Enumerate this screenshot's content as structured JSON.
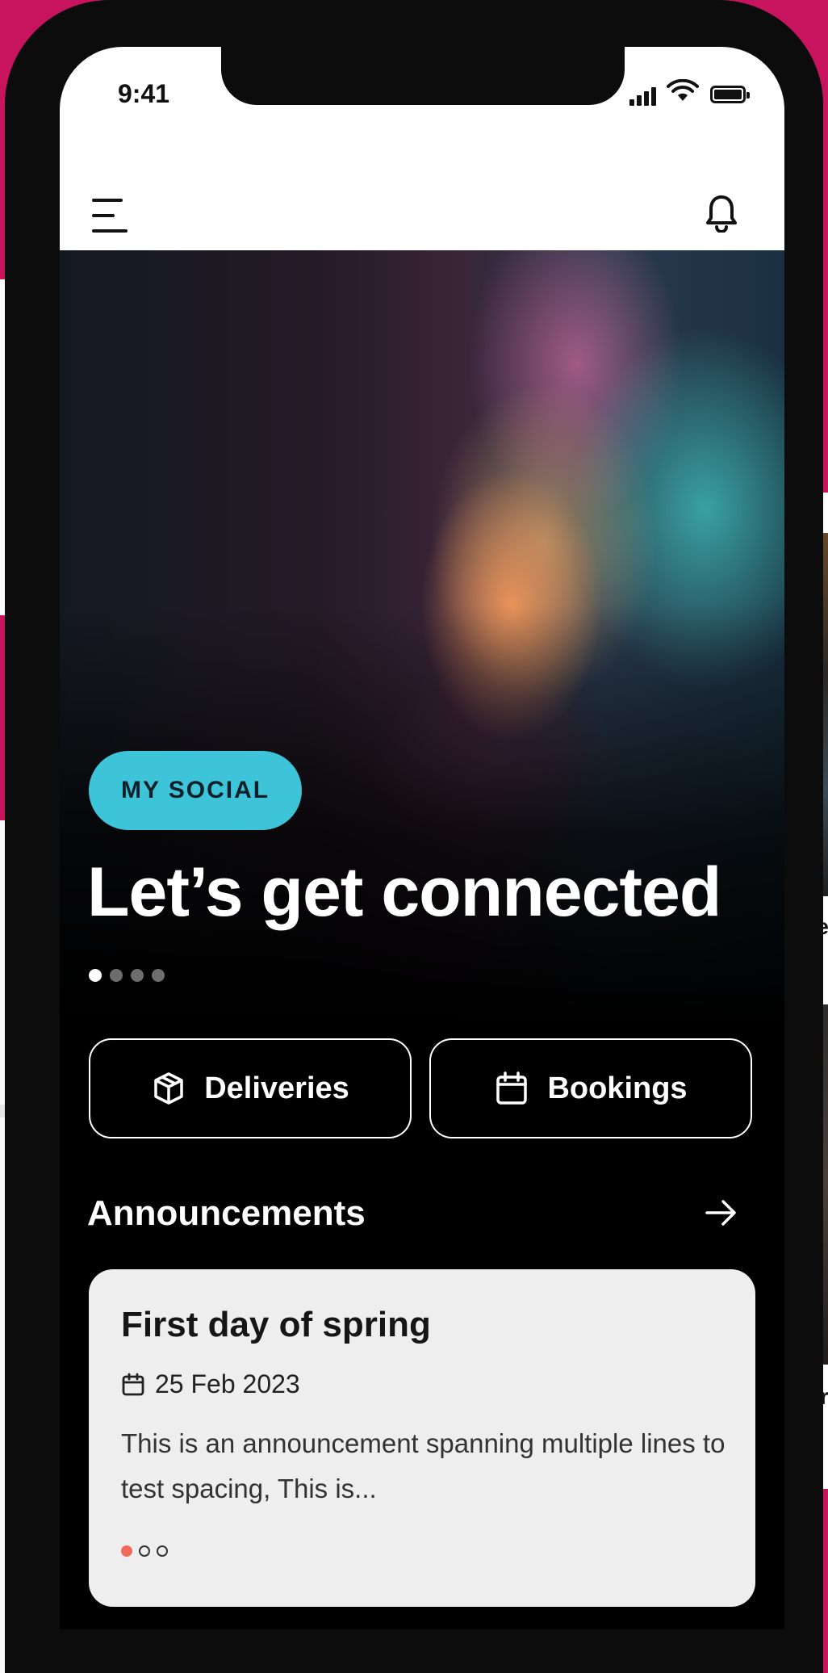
{
  "status_bar": {
    "time": "9:41"
  },
  "app_bar": {
    "menu_icon": "menu-icon",
    "notification_icon": "bell-icon"
  },
  "hero": {
    "tag": "MY SOCIAL",
    "title": "Let’s get connected",
    "slides": 4,
    "active_slide": 1
  },
  "quick_actions": [
    {
      "label": "Deliveries",
      "icon": "package-icon"
    },
    {
      "label": "Bookings",
      "icon": "calendar-icon"
    }
  ],
  "announcements": {
    "header": "Announcements",
    "items": [
      {
        "title": "First day of spring",
        "date": "25 Feb 2023",
        "body": "This is an announcement spanning multiple lines to test spacing, This is..."
      }
    ],
    "pages": 3,
    "active_page": 1
  },
  "side_cards": [
    {
      "label_fragment": "Me"
    },
    {
      "label_fragment": "Cir"
    }
  ],
  "colors": {
    "background": "#c8145e",
    "tag": "#3ec4d8",
    "active_dot": "#f26a5b"
  }
}
